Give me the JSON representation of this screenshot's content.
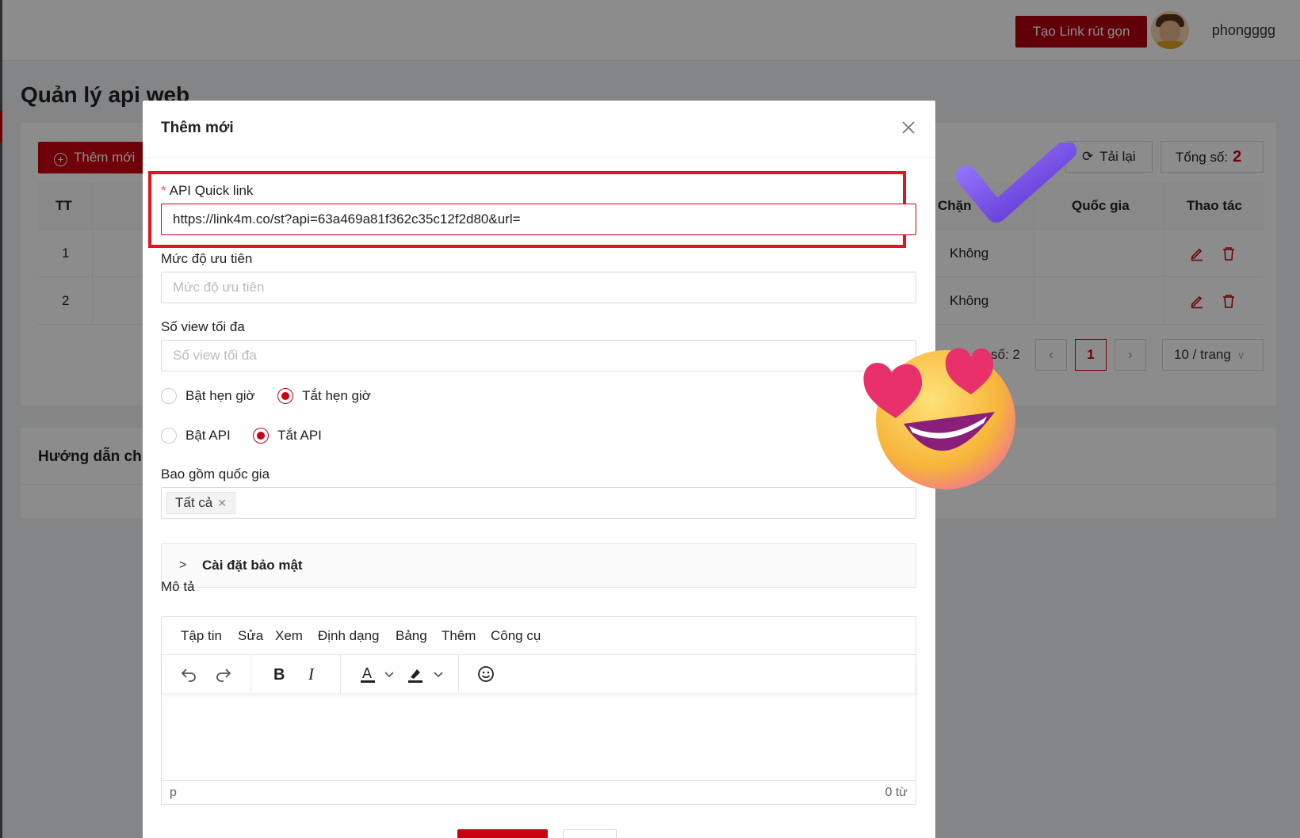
{
  "topbar": {
    "create_link_label": "Tạo Link rút gọn",
    "username": "phongggg"
  },
  "page": {
    "title": "Quản lý api web"
  },
  "toolbar": {
    "add_label": "Thêm mới",
    "reload_label": "Tải lại",
    "total_label": "Tổng số:",
    "total_value": "2"
  },
  "table": {
    "headers": {
      "tt": "TT",
      "block": "Chặn",
      "country": "Quốc gia",
      "actions": "Thao tác"
    },
    "rows": [
      {
        "tt": "1",
        "block": "Không"
      },
      {
        "tt": "2",
        "block": "Không"
      }
    ]
  },
  "pagination": {
    "total_text": "số: 2",
    "current_page": "1",
    "page_size": "10 / trang"
  },
  "guide": {
    "title": "Hướng dẫn ch"
  },
  "modal": {
    "title": "Thêm mới",
    "api_label": "API Quick link",
    "api_value": "https://link4m.co/st?api=63a469a81f362c35c12f2d80&url=",
    "priority_label": "Mức độ ưu tiên",
    "priority_placeholder": "Mức độ ưu tiên",
    "maxview_label": "Số view tối đa",
    "maxview_placeholder": "Số view tối đa",
    "schedule_on": "Bật hẹn giờ",
    "schedule_off": "Tắt hẹn giờ",
    "api_on": "Bật API",
    "api_off": "Tắt API",
    "country_label": "Bao gồm quốc gia",
    "country_tag": "Tất cả",
    "security_label": "Cài đặt bảo mật",
    "desc_label": "Mô tả",
    "editor_menu": [
      "Tập tin",
      "Sửa",
      "Xem",
      "Định dạng",
      "Bảng",
      "Thêm",
      "Công cụ"
    ],
    "status_path": "p",
    "word_count": "0 từ"
  },
  "colors": {
    "accent": "#c8000f",
    "highlight": "#e0161e"
  }
}
